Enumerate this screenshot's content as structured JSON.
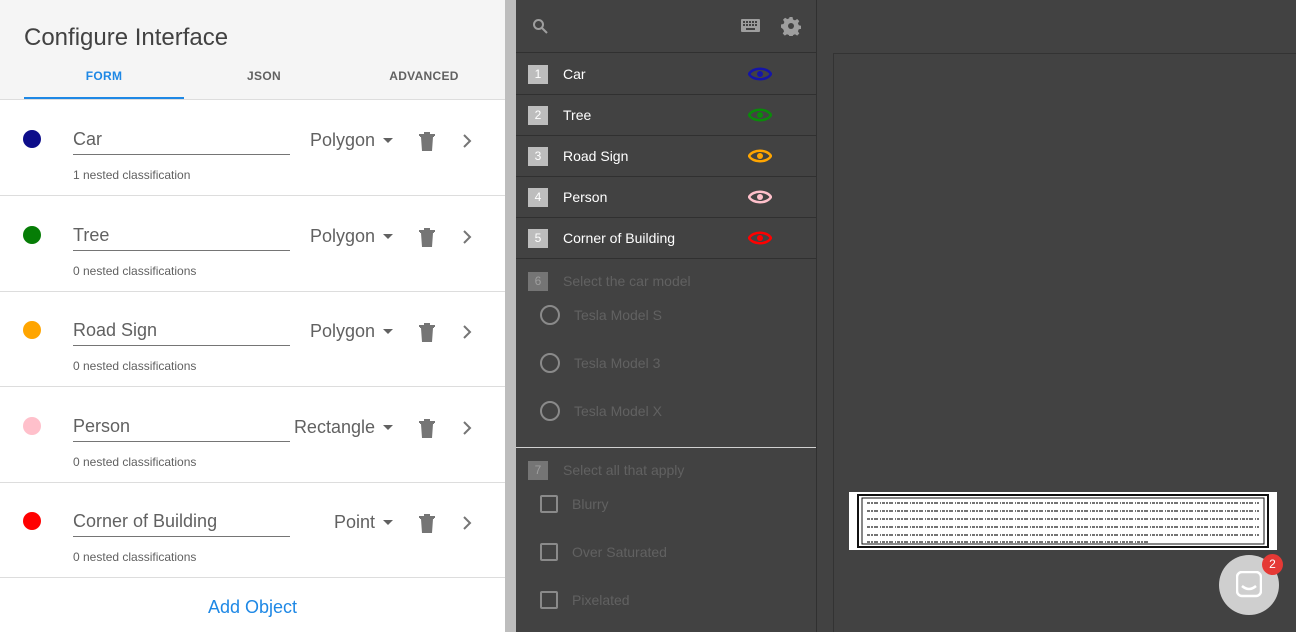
{
  "left_panel": {
    "title": "Configure Interface",
    "tabs": [
      "FORM",
      "JSON",
      "ADVANCED"
    ],
    "objects": [
      {
        "name": "Car",
        "nested": "1 nested classification",
        "type": "Polygon",
        "color": "#0d0d8a"
      },
      {
        "name": "Tree",
        "nested": "0 nested classifications",
        "type": "Polygon",
        "color": "#067d06"
      },
      {
        "name": "Road Sign",
        "nested": "0 nested classifications",
        "type": "Polygon",
        "color": "#ffa500"
      },
      {
        "name": "Person",
        "nested": "0 nested classifications",
        "type": "Rectangle",
        "color": "#ffc0cb"
      },
      {
        "name": "Corner of Building",
        "nested": "0 nested classifications",
        "type": "Point",
        "color": "#ff0000"
      }
    ],
    "add_object_label": "Add Object"
  },
  "middle_panel": {
    "toolbar_icons": [
      "search-icon",
      "keyboard-icon",
      "gear-icon"
    ],
    "tools": [
      {
        "number": "1",
        "label": "Car",
        "eye_color": "#1515a8"
      },
      {
        "number": "2",
        "label": "Tree",
        "eye_color": "#0a8a0a"
      },
      {
        "number": "3",
        "label": "Road Sign",
        "eye_color": "#ffa500"
      },
      {
        "number": "4",
        "label": "Person",
        "eye_color": "#ffc0cb"
      },
      {
        "number": "5",
        "label": "Corner of Building",
        "eye_color": "#ff0000"
      }
    ],
    "question_1": {
      "number": "6",
      "title": "Select the car model",
      "options": [
        "Tesla Model S",
        "Tesla Model 3",
        "Tesla Model X"
      ]
    },
    "question_2": {
      "number": "7",
      "title": "Select all that apply",
      "options": [
        "Blurry",
        "Over Saturated",
        "Pixelated"
      ]
    }
  },
  "chat": {
    "badge_count": "2"
  }
}
